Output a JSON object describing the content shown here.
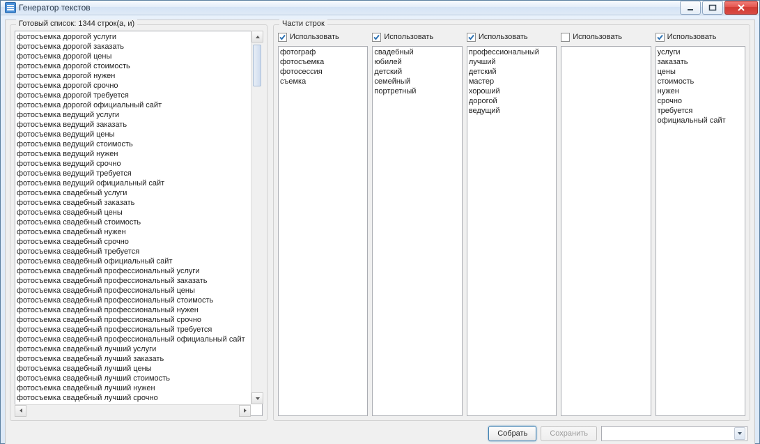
{
  "window": {
    "title": "Генератор текстов"
  },
  "left_panel": {
    "title_prefix": "Готовый список: ",
    "count": 1344,
    "title_suffix": " строк(а, и)",
    "items": [
      "фотосъемка дорогой услуги",
      "фотосъемка дорогой заказать",
      "фотосъемка дорогой цены",
      "фотосъемка дорогой стоимость",
      "фотосъемка дорогой нужен",
      "фотосъемка дорогой срочно",
      "фотосъемка дорогой требуется",
      "фотосъемка дорогой официальный сайт",
      "фотосъемка ведущий услуги",
      "фотосъемка ведущий заказать",
      "фотосъемка ведущий цены",
      "фотосъемка ведущий стоимость",
      "фотосъемка ведущий нужен",
      "фотосъемка ведущий срочно",
      "фотосъемка ведущий требуется",
      "фотосъемка ведущий официальный сайт",
      "фотосъемка свадебный услуги",
      "фотосъемка свадебный заказать",
      "фотосъемка свадебный цены",
      "фотосъемка свадебный стоимость",
      "фотосъемка свадебный нужен",
      "фотосъемка свадебный срочно",
      "фотосъемка свадебный требуется",
      "фотосъемка свадебный официальный сайт",
      "фотосъемка свадебный профессиональный услуги",
      "фотосъемка свадебный профессиональный заказать",
      "фотосъемка свадебный профессиональный цены",
      "фотосъемка свадебный профессиональный стоимость",
      "фотосъемка свадебный профессиональный нужен",
      "фотосъемка свадебный профессиональный срочно",
      "фотосъемка свадебный профессиональный требуется",
      "фотосъемка свадебный профессиональный официальный сайт",
      "фотосъемка свадебный лучший услуги",
      "фотосъемка свадебный лучший заказать",
      "фотосъемка свадебный лучший цены",
      "фотосъемка свадебный лучший стоимость",
      "фотосъемка свадебный лучший нужен",
      "фотосъемка свадебный лучший срочно"
    ]
  },
  "right_panel": {
    "title": "Части строк",
    "use_label": "Использовать",
    "columns": [
      {
        "checked": true,
        "items": [
          "фотограф",
          "фотосъемка",
          "фотосессия",
          "съемка"
        ]
      },
      {
        "checked": true,
        "items": [
          "свадебный",
          "юбилей",
          "детский",
          "семейный",
          "портретный"
        ]
      },
      {
        "checked": true,
        "items": [
          "профессиональный",
          "лучший",
          "детский",
          "мастер",
          "хороший",
          "дорогой",
          "ведущий"
        ]
      },
      {
        "checked": false,
        "items": []
      },
      {
        "checked": true,
        "items": [
          "услуги",
          "заказать",
          "цены",
          "стоимость",
          "нужен",
          "срочно",
          "требуется",
          "официальный сайт"
        ]
      }
    ]
  },
  "buttons": {
    "build": "Собрать",
    "save": "Сохранить"
  }
}
